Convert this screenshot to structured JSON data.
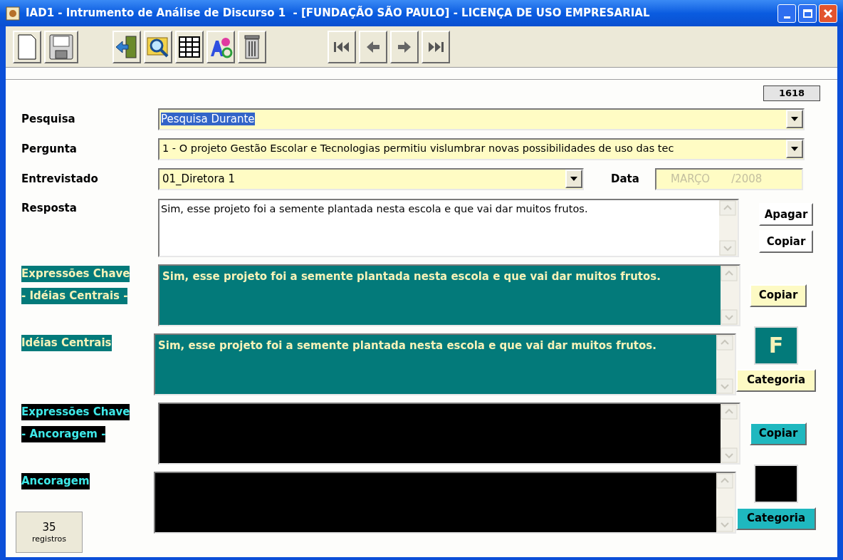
{
  "window": {
    "title": "IAD1 - Intrumento de Análise de Discurso 1  - [FUNDAÇÃO SÃO PAULO] - LICENÇA DE USO EMPRESARIAL"
  },
  "record_number": "1618",
  "fields": {
    "pesquisa": {
      "label": "Pesquisa",
      "value": "Pesquisa Durante",
      "text_selected": true
    },
    "pergunta": {
      "label": "Pergunta",
      "value": "1 - O projeto Gestão Escolar e Tecnologias permitiu vislumbrar novas possibilidades de uso das tec"
    },
    "entrevistado": {
      "label": "Entrevistado",
      "value": "01_Diretora 1"
    },
    "data": {
      "label": "Data",
      "month": "MARÇO",
      "year": "/2008",
      "disabled": true
    },
    "resposta": {
      "label": "Resposta",
      "value": "Sim, esse projeto foi a semente plantada nesta escola e que vai dar muitos frutos.",
      "buttons": [
        "Apagar",
        "Copiar"
      ]
    }
  },
  "panels": [
    {
      "kind": "ideias",
      "label_lines": [
        "Expressões Chave",
        "- Idéias Centrais -"
      ],
      "value": "Sim, esse projeto foi a semente plantada nesta escola e que vai dar muitos frutos.",
      "side": {
        "kind": "copy",
        "button": "Copiar"
      }
    },
    {
      "kind": "ideias",
      "label_lines": [
        "Idéias Centrais"
      ],
      "value": "Sim, esse projeto foi a semente plantada nesta escola e que vai dar muitos frutos.",
      "side": {
        "kind": "category",
        "category": "F",
        "button": "Categoria"
      }
    },
    {
      "kind": "ancoragem",
      "label_lines": [
        "Expressões Chave",
        "- Ancoragem -"
      ],
      "side": {
        "kind": "copy",
        "button": "Copiar"
      }
    },
    {
      "kind": "ancoragem",
      "label_lines": [
        "Ancoragem"
      ],
      "side": {
        "kind": "category",
        "button": "Categoria"
      }
    }
  ],
  "record_count": {
    "number": "35",
    "label": "registros"
  }
}
